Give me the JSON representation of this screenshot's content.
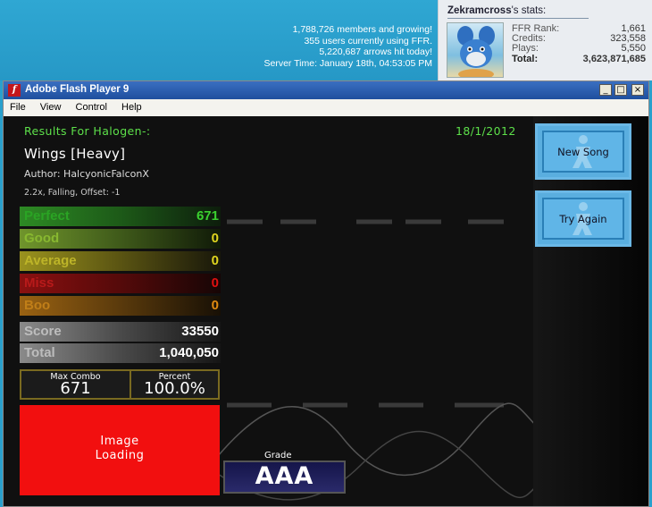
{
  "site": {
    "stats_lines": [
      "1,788,726 members and growing!",
      "355 users currently using FFR.",
      "5,220,687 arrows hit today!",
      "Server Time: January 18th, 04:53:05 PM"
    ]
  },
  "user_panel": {
    "username": "Zekramcross",
    "suffix": "'s stats:",
    "stats": [
      {
        "label": "FFR Rank:",
        "value": "1,661"
      },
      {
        "label": "Credits:",
        "value": "323,558"
      },
      {
        "label": "Plays:",
        "value": "5,550"
      },
      {
        "label": "Total:",
        "value": "3,623,871,685"
      }
    ]
  },
  "window": {
    "title": "Adobe Flash Player 9",
    "menu": [
      "File",
      "View",
      "Control",
      "Help"
    ],
    "controls": {
      "minimize": "_",
      "maximize": "□",
      "close": "×"
    }
  },
  "results": {
    "header": "Results For Halogen-:",
    "date": "18/1/2012",
    "song_title": "Wings [Heavy]",
    "author": "Author: HalcyonicFalconX",
    "settings": "2.2x, Falling, Offset: -1",
    "judgements": [
      {
        "label": "Perfect",
        "value": "671",
        "color": "#3bd12f"
      },
      {
        "label": "Good",
        "value": "0",
        "color": "#9ad13c"
      },
      {
        "label": "Average",
        "value": "0",
        "color": "#e0d51f"
      },
      {
        "label": "Miss",
        "value": "0",
        "color": "#e01010"
      },
      {
        "label": "Boo",
        "value": "0",
        "color": "#e08a10"
      }
    ],
    "score_label": "Score",
    "score": "33550",
    "total_label": "Total",
    "total": "1,040,050",
    "max_combo_label": "Max Combo",
    "max_combo": "671",
    "percent_label": "Percent",
    "percent": "100.0%",
    "image_loading": [
      "Image",
      "Loading"
    ],
    "grade_label": "Grade",
    "grade": "AAA"
  },
  "buttons": {
    "new_song": "New Song",
    "try_again": "Try Again"
  },
  "colors": {
    "accent_green": "#5de04a",
    "button_blue": "#5aaedf",
    "loading_red": "#f20f0f"
  }
}
